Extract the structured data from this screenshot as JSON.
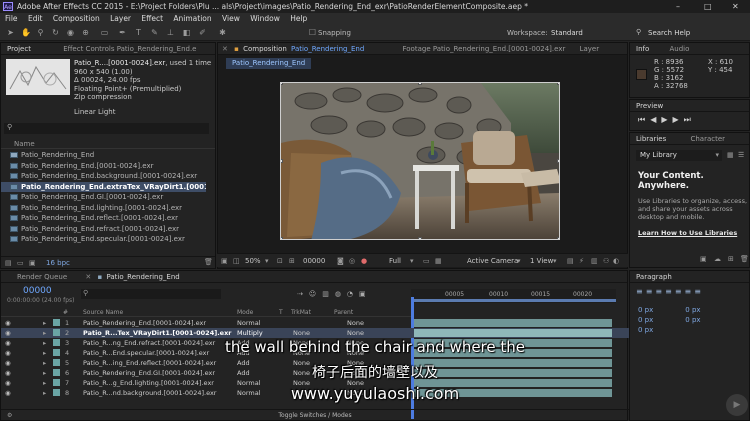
{
  "app": {
    "title": "Adobe After Effects CC 2015 - E:\\Project Folders\\Plu ... als\\Project\\images\\Patio_Rendering_End_exr\\PatioRenderElementComposite.aep *",
    "logo": "Ae",
    "window_controls": [
      "–",
      "□",
      "✕"
    ]
  },
  "menu": [
    "File",
    "Edit",
    "Composition",
    "Layer",
    "Effect",
    "Animation",
    "View",
    "Window",
    "Help"
  ],
  "toolbar": {
    "snapping": "Snapping",
    "workspace_label": "Workspace:",
    "workspace_value": "Standard",
    "search_help": "Search Help"
  },
  "project_panel": {
    "tabs": [
      "Project",
      "Effect Controls Patio_Rendering_End.e"
    ],
    "info": {
      "name": "Patio_R....[0001-0024].exr",
      "used": ", used 1 time",
      "size": "960 x 540 (1.00)",
      "duration": "Δ 00024, 24.00 fps",
      "format": "Floating Point+ (Premultiplied)",
      "compression": "Zip compression",
      "color": "Linear Light"
    },
    "search_placeholder": "",
    "column_name": "Name",
    "items": [
      {
        "label": "Patio_Rendering_End",
        "selected": false
      },
      {
        "label": "Patio_Rendering_End.[0001-0024].exr",
        "selected": false
      },
      {
        "label": "Patio_Rendering_End.background.[0001-0024].exr",
        "selected": false
      },
      {
        "label": "Patio_Rendering_End.extraTex_VRayDirt1.[0001-0024]",
        "selected": true
      },
      {
        "label": "Patio_Rendering_End.GI.[0001-0024].exr",
        "selected": false
      },
      {
        "label": "Patio_Rendering_End.lighting.[0001-0024].exr",
        "selected": false
      },
      {
        "label": "Patio_Rendering_End.reflect.[0001-0024].exr",
        "selected": false
      },
      {
        "label": "Patio_Rendering_End.refract.[0001-0024].exr",
        "selected": false
      },
      {
        "label": "Patio_Rendering_End.specular.[0001-0024].exr",
        "selected": false
      }
    ],
    "bpc": "16 bpc"
  },
  "composition_panel": {
    "tab_label": "Composition",
    "tab_name": "Patio_Rendering_End",
    "footage_tab": "Footage Patio_Rendering_End.[0001-0024].exr",
    "layer_tab": "Layer",
    "subtab": "Patio_Rendering_End",
    "zoom": "50%",
    "timecode": "00000",
    "resolution": "Full",
    "camera": "Active Camera",
    "view": "1 View",
    "exposure": "+0.0"
  },
  "info_panel": {
    "tabs": [
      "Info",
      "Audio"
    ],
    "R": "R : 8936",
    "G": "G : 5572",
    "B": "B : 3162",
    "A": "A : 32768",
    "X": "X : 610",
    "Y": "Y : 454",
    "swatch": "#4a3a2e"
  },
  "preview_panel": {
    "label": "Preview"
  },
  "libraries_panel": {
    "tabs": [
      "Libraries",
      "Character"
    ],
    "library": "My Library",
    "heading": "Your Content. Anywhere.",
    "body": "Use Libraries to organize, access, and share your assets across desktop and mobile.",
    "link": "Learn How to Use Libraries"
  },
  "paragraph_panel": {
    "label": "Paragraph",
    "fields": [
      "0 px",
      "0 px",
      "0 px",
      "0 px",
      "0 px"
    ]
  },
  "timeline": {
    "tabs": [
      "Render Queue",
      "Patio_Rendering_End"
    ],
    "timecode": "00000",
    "timecode_sub": "0:00:00:00 (24.00 fps)",
    "columns": [
      "#",
      "Source Name",
      "Mode",
      "T",
      "TrkMat",
      "Parent"
    ],
    "ruler": [
      "00005",
      "00010",
      "00015",
      "00020"
    ],
    "layers": [
      {
        "num": "1",
        "name": "Patio_Rendering_End.[0001-0024].exr",
        "mode": "Normal",
        "trkmat": "",
        "parent": "None",
        "selected": false
      },
      {
        "num": "2",
        "name": "Patio_R...Tex_VRayDirt1.[0001-0024].exr",
        "mode": "Multiply",
        "trkmat": "None",
        "parent": "None",
        "selected": true
      },
      {
        "num": "3",
        "name": "Patio_R...ng_End.refract.[0001-0024].exr",
        "mode": "Add",
        "trkmat": "None",
        "parent": "None",
        "selected": false
      },
      {
        "num": "4",
        "name": "Patio_R...End.specular.[0001-0024].exr",
        "mode": "Add",
        "trkmat": "None",
        "parent": "None",
        "selected": false
      },
      {
        "num": "5",
        "name": "Patio_R...ing_End.reflect.[0001-0024].exr",
        "mode": "Add",
        "trkmat": "None",
        "parent": "None",
        "selected": false
      },
      {
        "num": "6",
        "name": "Patio_Rendering_End.GI.[0001-0024].exr",
        "mode": "Add",
        "trkmat": "None",
        "parent": "None",
        "selected": false
      },
      {
        "num": "7",
        "name": "Patio_R...g_End.lighting.[0001-0024].exr",
        "mode": "Normal",
        "trkmat": "None",
        "parent": "None",
        "selected": false
      },
      {
        "num": "8",
        "name": "Patio_R...nd.background.[0001-0024].exr",
        "mode": "Normal",
        "trkmat": "None",
        "parent": "None",
        "selected": false
      }
    ],
    "toggle": "Toggle Switches / Modes"
  },
  "subtitles": {
    "english": "the wall behind the chair and where the",
    "chinese": "椅子后面的墙壁以及",
    "watermark": "www.yuyulaoshi.com"
  }
}
